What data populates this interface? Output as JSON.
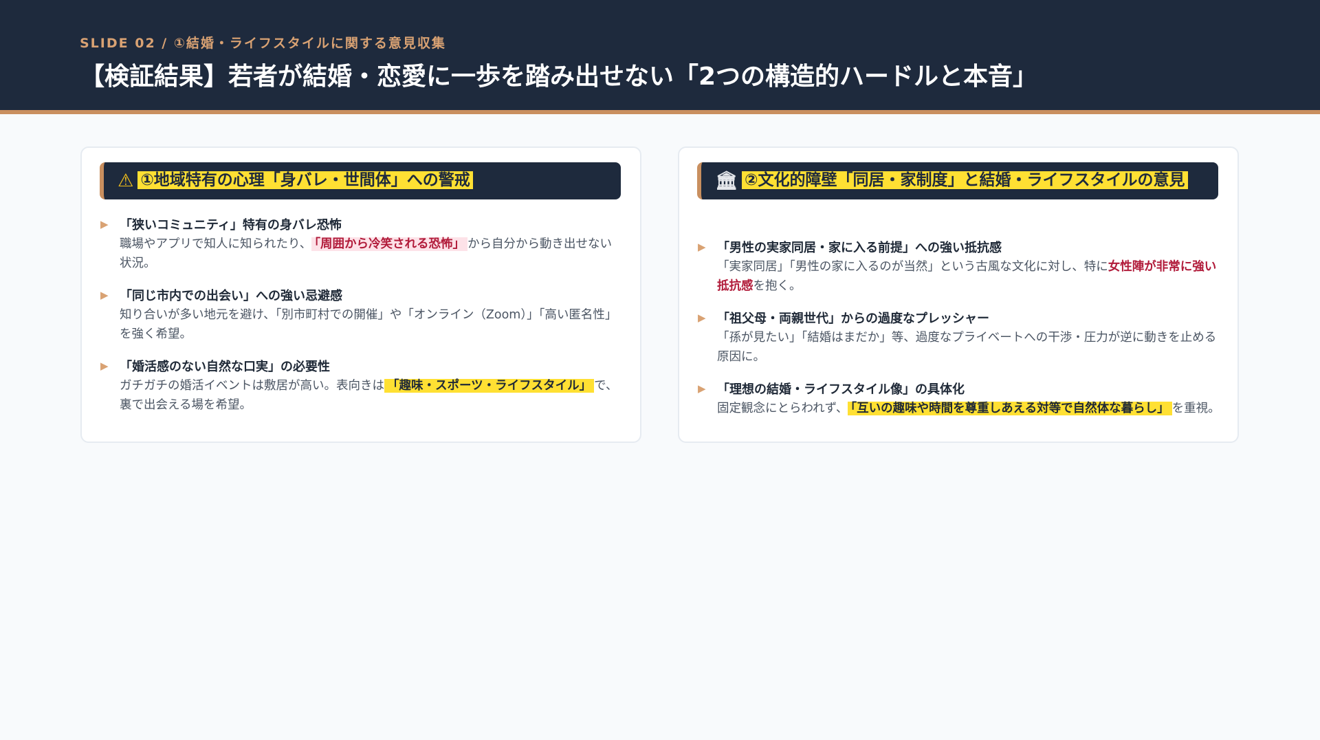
{
  "header": {
    "label": "SLIDE 02 / ①結婚・ライフスタイルに関する意見収集",
    "title": "【検証結果】若者が結婚・恋愛に一歩を踏み出せない「2つの構造的ハードルと本音」"
  },
  "colors": {
    "navy": "#1e2a3d",
    "accent": "#c98f5f",
    "highlight": "#ffe033",
    "alert": "#b11b3a"
  },
  "cards": [
    {
      "icon": "warning-icon",
      "icon_glyph": "⚠",
      "title": "①地域特有の心理「身バレ・世間体」への警戒",
      "items": [
        {
          "title": "「狭いコミュニティ」特有の身バレ恐怖",
          "body_pre": "職場やアプリで知人に知られたり、",
          "body_em": "「周囲から冷笑される恐怖」",
          "body_post": "から自分から動き出せない状況。"
        },
        {
          "title": "「同じ市内での出会い」への強い忌避感",
          "body": "知り合いが多い地元を避け、「別市町村での開催」や「オンライン（Zoom）」「高い匿名性」を強く希望。"
        },
        {
          "title": "「婚活感のない自然な口実」の必要性",
          "body_pre": "ガチガチの婚活イベントは敷居が高い。表向きは",
          "body_em": "「趣味・スポーツ・ライフスタイル」",
          "body_post": "で、裏で出会える場を希望。"
        }
      ]
    },
    {
      "icon": "bank-icon",
      "icon_glyph": "🏛",
      "title": "②文化的障壁「同居・家制度」と結婚・ライフスタイルの意見",
      "items": [
        {
          "title": "「男性の実家同居・家に入る前提」への強い抵抗感",
          "body_pre": "「実家同居」「男性の家に入るのが当然」という古風な文化に対し、特に",
          "body_em": "女性陣が非常に強い抵抗感",
          "body_post": "を抱く。"
        },
        {
          "title": "「祖父母・両親世代」からの過度なプレッシャー",
          "body": "「孫が見たい」「結婚はまだか」等、過度なプライベートへの干渉・圧力が逆に動きを止める原因に。"
        },
        {
          "title": "「理想の結婚・ライフスタイル像」の具体化",
          "body_pre": "固定観念にとらわれず、",
          "body_em": "「互いの趣味や時間を尊重しあえる対等で自然体な暮らし」",
          "body_post": "を重視。"
        }
      ]
    }
  ]
}
